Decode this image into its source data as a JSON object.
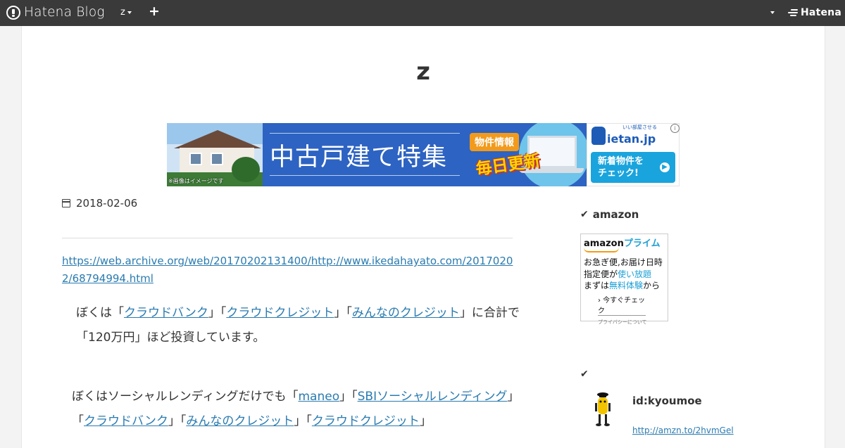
{
  "header": {
    "logo_text": "Hatena Blog",
    "blog_switch_label": "z",
    "new_post_label": "+",
    "hatena_label": "Hatena"
  },
  "blog": {
    "title": "z"
  },
  "ad": {
    "title": "中古戸建て特集",
    "tag": "物件情報",
    "daily": "毎日更新",
    "image_note": "※画像はイメージです",
    "side_logo": "ietan.jp",
    "side_logo_sub": "いい部屋させる",
    "side_button": "新着物件を チェック!",
    "info_icon": "i"
  },
  "entry": {
    "date": "2018-02-06",
    "source_link": "https://web.archive.org/web/20170202131400/http://www.ikedahayato.com/20170202/68794994.html",
    "p1": {
      "t1": "ぼくは「",
      "l1": "クラウドバンク",
      "t2": "」「",
      "l2": "クラウドクレジット",
      "t3": "」「",
      "l3": "みんなのクレジット",
      "t4": "」に合計で「120万円」ほど投資しています。"
    },
    "p2": {
      "t1": "ぼくはソーシャルレンディングだけでも「",
      "l1": "maneo",
      "t2": "」「",
      "l2": "SBIソーシャルレンディング",
      "t3": "」「",
      "l3": "クラウドバンク",
      "t4": "」「",
      "l4": "みんなのクレジット",
      "t5": "」「",
      "l5": "クラウドクレジット",
      "t6": "」"
    }
  },
  "sidebar": {
    "amazon_heading": "amazon",
    "amazon_ad": {
      "logo": "amazon",
      "logo_prime": "プライム",
      "line1": "お急ぎ便,お届け日時",
      "line2a": "指定便が",
      "line2b": "使い放題",
      "line3a": "まずは",
      "line3b": "無料体験",
      "line3c": "から",
      "cta": "› 今すぐチェック",
      "privacy": "プライバシーについて"
    },
    "profile": {
      "id": "id:kyoumoe",
      "link": "http://amzn.to/2hvmGel"
    }
  },
  "colors": {
    "topbar_bg": "#3a3a3a",
    "link": "#2a7bb0",
    "ad_blue": "#2d63c2",
    "prime_blue": "#1ea0d6"
  },
  "icons": [
    "hatena-logo-icon",
    "caret-down-icon",
    "plus-icon",
    "hatena-bird-icon",
    "calendar-icon",
    "check-icon"
  ]
}
